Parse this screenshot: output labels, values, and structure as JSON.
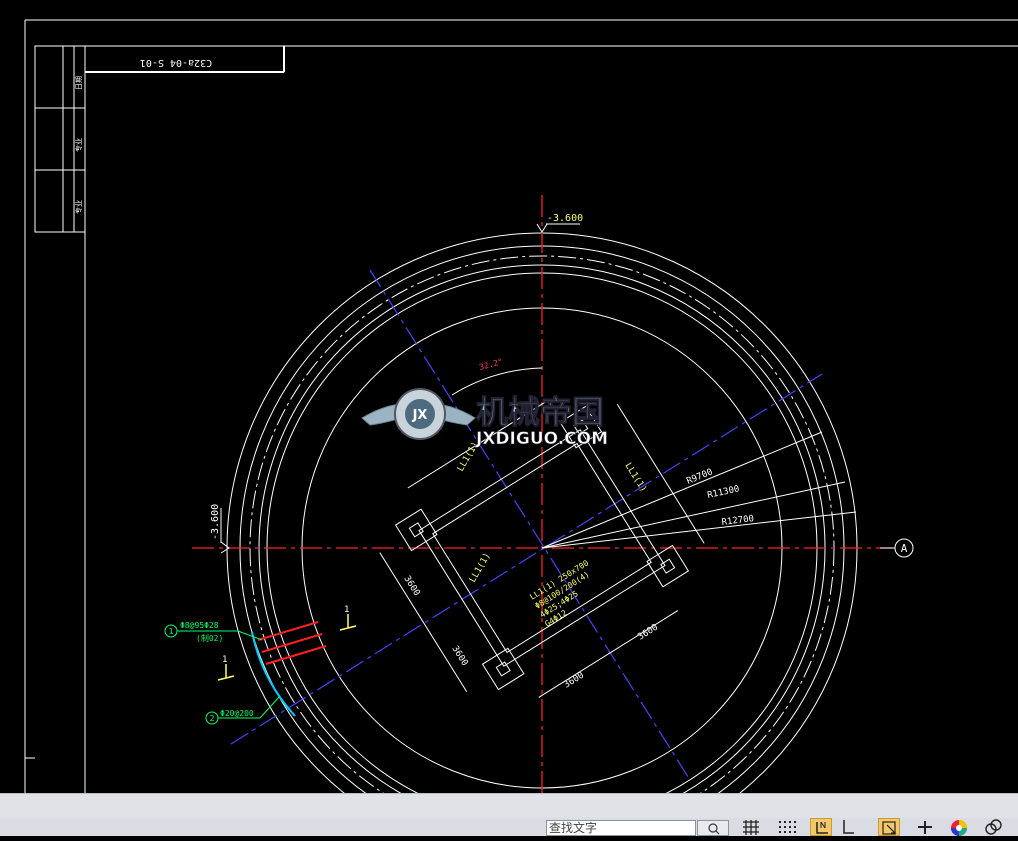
{
  "drawing": {
    "code_label": "C32a-04 S-01",
    "elevation_top": "-3.600",
    "elevation_left": "-3.600",
    "angle_label": "32.2°",
    "axis_bubble": "A",
    "radius_labels": [
      "R9700",
      "R11300",
      "R12700"
    ],
    "beam_labels": [
      "LL1(1)",
      "LL1(1)",
      "LL1(1)"
    ],
    "beam_spec": [
      "LL1(1) 250x700",
      "Φ8@100/200(4)",
      "4Φ25;4Φ25",
      "G4Φ12"
    ],
    "dimensions": [
      "3600",
      "3600",
      "3600",
      "3600"
    ],
    "section_marks": [
      "1",
      "1"
    ],
    "callout_1": {
      "number": "1",
      "text": "Φ8@95Φ28",
      "sub": "(制02)"
    },
    "callout_2": {
      "number": "2",
      "text": "Φ20@200"
    },
    "title_block_chars": [
      "日期",
      "专业",
      "专业"
    ]
  },
  "watermark": {
    "cn_text": "机械帝国",
    "en_text": "JXDIGUO.COM",
    "emblem_text": "JX"
  },
  "statusbar": {
    "search_placeholder": "查找文字"
  },
  "colors": {
    "background": "#000000",
    "line_white": "#ffffff",
    "center_red": "#ff2020",
    "blue_axis": "#3a3aff",
    "dimension_yellow": "#ffff66",
    "callout_green": "#00ff66",
    "arc_cyan": "#00ccff",
    "statusbar": "#d9dde3"
  }
}
